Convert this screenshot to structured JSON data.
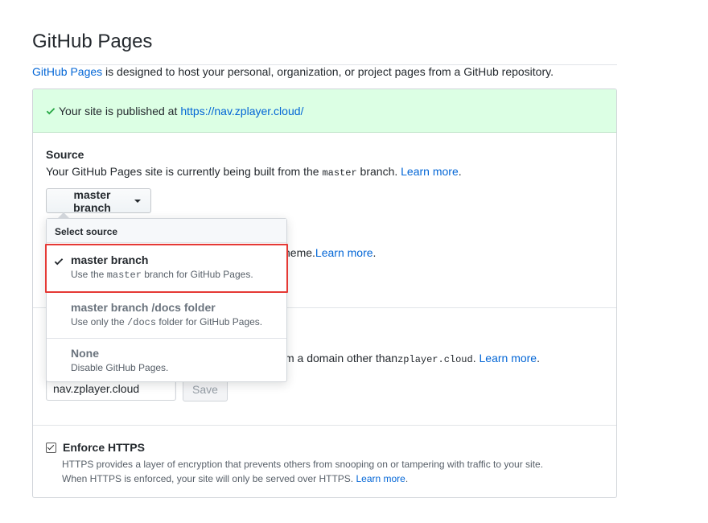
{
  "title": "GitHub Pages",
  "intro": {
    "link_text": "GitHub Pages",
    "text": " is designed to host your personal, organization, or project pages from a GitHub repository."
  },
  "flash": {
    "message": "Your site is published at",
    "url": "https://nav.zplayer.cloud/"
  },
  "source": {
    "heading": "Source",
    "desc_before": "Your GitHub Pages site is currently being built from the ",
    "branch_code": "master",
    "desc_after": " branch. ",
    "learn_more": "Learn more",
    "button_label": "master branch"
  },
  "theme": {
    "visible_text": "heme. ",
    "learn_more": "Learn more"
  },
  "custom_domain": {
    "visible_text": "m a domain other than ",
    "domain_code": "zplayer.cloud",
    "period": ". ",
    "learn_more": "Learn more",
    "input_value": "nav.zplayer.cloud",
    "save_label": "Save"
  },
  "https": {
    "label": "Enforce HTTPS",
    "checked": true,
    "note_line1": "HTTPS provides a layer of encryption that prevents others from snooping on or tampering with traffic to your site.",
    "note_line2": "When HTTPS is enforced, your site will only be served over HTTPS. ",
    "learn_more": "Learn more",
    "period": "."
  },
  "dropdown": {
    "header": "Select source",
    "items": [
      {
        "title": "master branch",
        "desc_before": "Use the ",
        "desc_code": "master",
        "desc_after": " branch for GitHub Pages.",
        "selected": true
      },
      {
        "title": "master branch /docs folder",
        "desc_before": "Use only the ",
        "desc_code": "/docs",
        "desc_after": " folder for GitHub Pages.",
        "selected": false
      },
      {
        "title": "None",
        "desc_before": "Disable GitHub Pages.",
        "desc_code": "",
        "desc_after": "",
        "selected": false
      }
    ]
  },
  "colors": {
    "link": "#0366d6",
    "success_bg": "#dcffe4",
    "success_icon": "#28a745",
    "highlight": "#e53935"
  },
  "icons": {
    "flash_check": "check-icon",
    "menu_check": "check-icon",
    "button_caret": "caret-down-icon"
  }
}
